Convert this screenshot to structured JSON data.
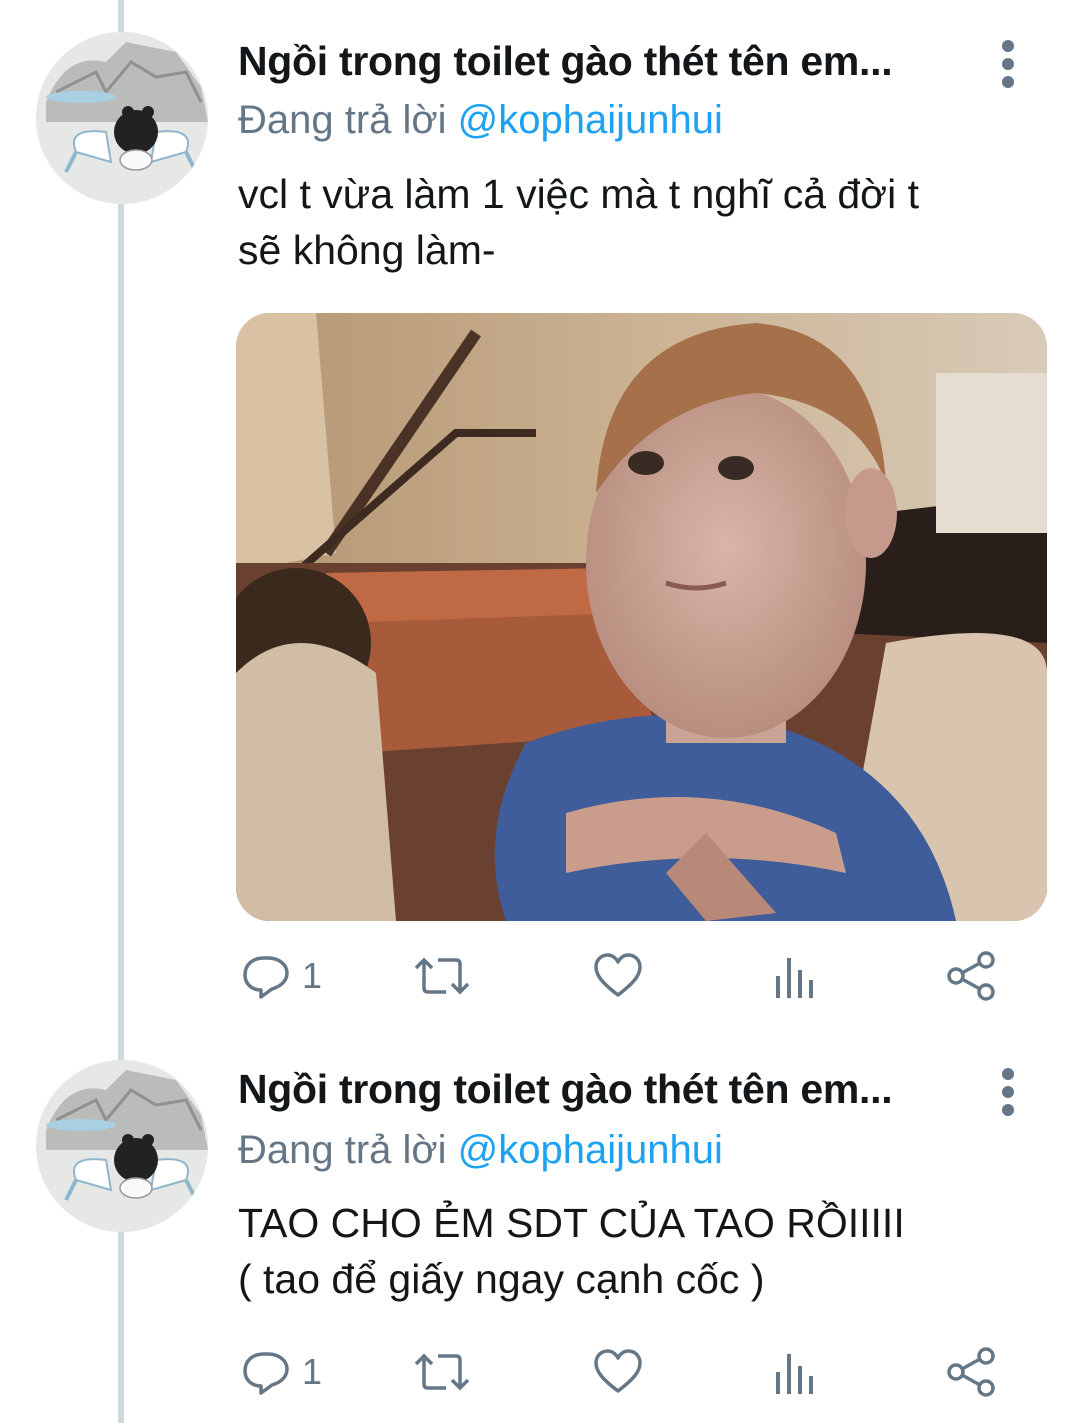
{
  "tweets": [
    {
      "display_name": "Ngồi trong toilet gào thét tên em...",
      "replying_prefix": "Đang trả lời",
      "replying_handle": "@kophaijunhui",
      "text_lines": [
        "vcl t vừa làm 1 việc mà t nghĩ cả đời t",
        "sẽ không làm-"
      ],
      "has_media": true,
      "media_description": "meme-photo-boy-arms-crossed",
      "reply_count": "1",
      "avatar_icon": "crying-cartoon-avatar"
    },
    {
      "display_name": "Ngồi trong toilet gào thét tên em...",
      "replying_prefix": "Đang trả lời",
      "replying_handle": "@kophaijunhui",
      "text_lines": [
        "TAO CHO ẺM SDT CỦA TAO RỒIIIII",
        "( tao để giấy ngay cạnh cốc )"
      ],
      "has_media": false,
      "reply_count": "1",
      "avatar_icon": "crying-cartoon-avatar"
    }
  ],
  "icons": {
    "reply": "reply-icon",
    "retweet": "retweet-icon",
    "like": "heart-icon",
    "analytics": "analytics-icon",
    "share": "share-icon",
    "more": "more-vertical-icon"
  },
  "colors": {
    "text": "#14171a",
    "secondary": "#657786",
    "link": "#1da1f2",
    "thread_line": "#cfd9de"
  }
}
